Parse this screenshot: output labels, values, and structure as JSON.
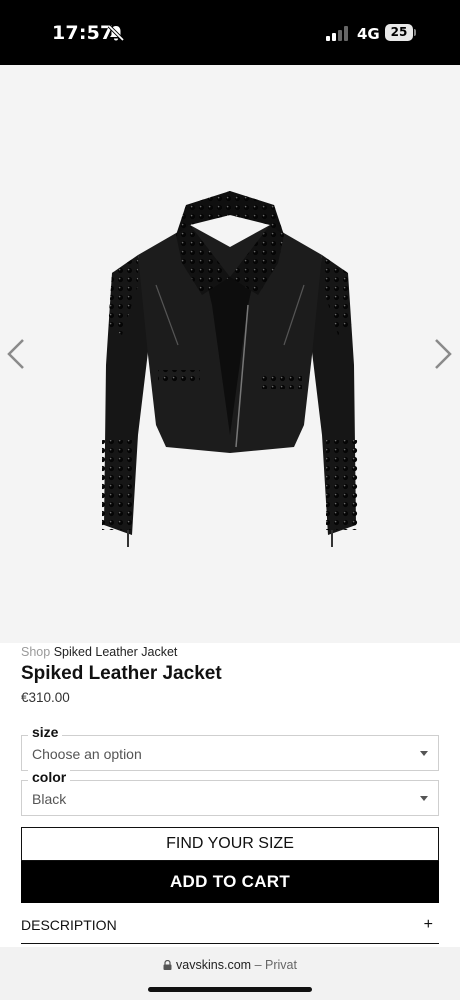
{
  "status_bar": {
    "time": "17:57",
    "network": "4G",
    "battery": "25"
  },
  "icons": {
    "bell": "bell-slash-icon",
    "signal": "signal-bars-icon",
    "battery": "battery-icon",
    "prev": "chevron-left-icon",
    "next": "chevron-right-icon",
    "lock": "lock-icon",
    "expand": "plus-icon"
  },
  "gallery": {
    "image_subject": "black studded leather jacket"
  },
  "breadcrumb": {
    "shop": "Shop",
    "current": "Spiked Leather Jacket"
  },
  "product": {
    "title": "Spiked Leather Jacket",
    "price": "€310.00"
  },
  "options": {
    "size": {
      "label": "size",
      "value": "Choose an option"
    },
    "color": {
      "label": "color",
      "value": "Black"
    }
  },
  "actions": {
    "find_size": "FIND YOUR SIZE",
    "add_to_cart": "ADD TO CART"
  },
  "description": {
    "label": "DESCRIPTION",
    "toggle": "+"
  },
  "browser": {
    "domain": "vavskins.com",
    "suffix": "– Privat"
  },
  "colors": {
    "status_bg": "#000000",
    "gallery_bg": "#f4f4f4",
    "cart_bg": "#000000"
  }
}
